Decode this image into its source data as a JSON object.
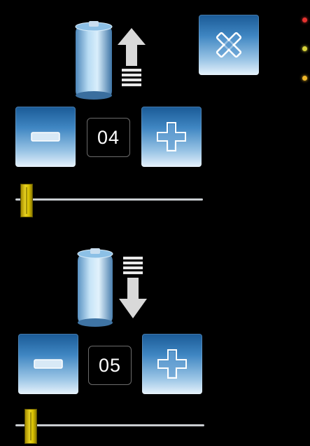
{
  "colors": {
    "led_red": "#e5322f",
    "led_yellow": "#d8d23a",
    "led_orange": "#efb72a",
    "button_gradient_top": "#1a5a96",
    "button_gradient_bottom": "#e6f2fb",
    "slider_thumb": "#e8d322"
  },
  "close_button": {
    "icon": "close-x-icon"
  },
  "status_leds": [
    {
      "name": "led-red",
      "color": "#e5322f"
    },
    {
      "name": "led-yellow",
      "color": "#d8d23a"
    },
    {
      "name": "led-orange",
      "color": "#efb72a"
    }
  ],
  "top_control": {
    "icon": "battery-icon",
    "direction_icon": "arrow-up-icon",
    "value": "04",
    "decrement_icon": "minus-icon",
    "increment_icon": "plus-icon",
    "slider_level": 0.06
  },
  "bottom_control": {
    "icon": "battery-icon",
    "direction_icon": "arrow-down-icon",
    "value": "05",
    "decrement_icon": "minus-icon",
    "increment_icon": "plus-icon",
    "slider_level": 0.07
  }
}
